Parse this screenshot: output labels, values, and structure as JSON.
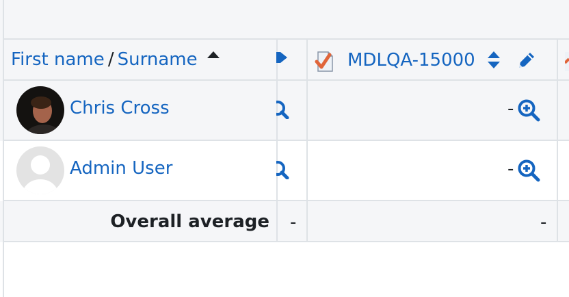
{
  "header": {
    "sort_first_name": "First name",
    "sort_separator": "/",
    "sort_surname": "Surname",
    "sort_indicator": "ascending",
    "grade_item_name": "MDLQA-15000"
  },
  "rows": [
    {
      "name": "Chris Cross",
      "grade": "-"
    },
    {
      "name": "Admin User",
      "grade": "-"
    }
  ],
  "footer": {
    "overall_label": "Overall average",
    "overall_left_value": "-",
    "overall_grade_value": "-"
  },
  "colors": {
    "link": "#1565c0",
    "row_gray": "#f5f6f8",
    "border": "#dee2e6",
    "checkmark": "#e0653a"
  },
  "icons": [
    "sort-asc-icon",
    "edit-pencil-icon",
    "assignment-icon",
    "sort-updown-icon",
    "zoom-in-icon",
    "avatar-photo",
    "avatar-placeholder"
  ]
}
